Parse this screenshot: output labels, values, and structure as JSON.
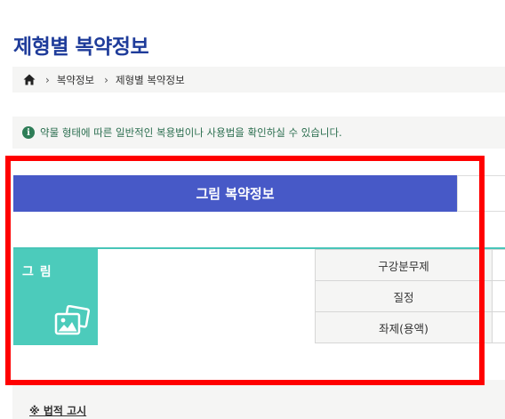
{
  "page": {
    "title": "제형별 복약정보"
  },
  "breadcrumb": {
    "home_icon": "home-icon",
    "items": [
      "복약정보",
      "제형별 복약정보"
    ]
  },
  "notice": {
    "icon": "info-icon",
    "icon_glyph": "i",
    "text": "약물 형태에 따른 일반적인 복용법이나 사용법을 확인하실 수 있습니다."
  },
  "section": {
    "tab_label": "그림 복약정보"
  },
  "image_card": {
    "label": "그 림",
    "icon": "photo-icon"
  },
  "info_rows": [
    "구강분무제",
    "질정",
    "좌제(용액)"
  ],
  "footer": {
    "legal_label": "※ 법적 고시"
  },
  "colors": {
    "title": "#1f3c9a",
    "tab_bar": "#4759c7",
    "teal": "#4ccbbb",
    "highlight": "#ff0000",
    "notice_text": "#2b6e4f"
  }
}
